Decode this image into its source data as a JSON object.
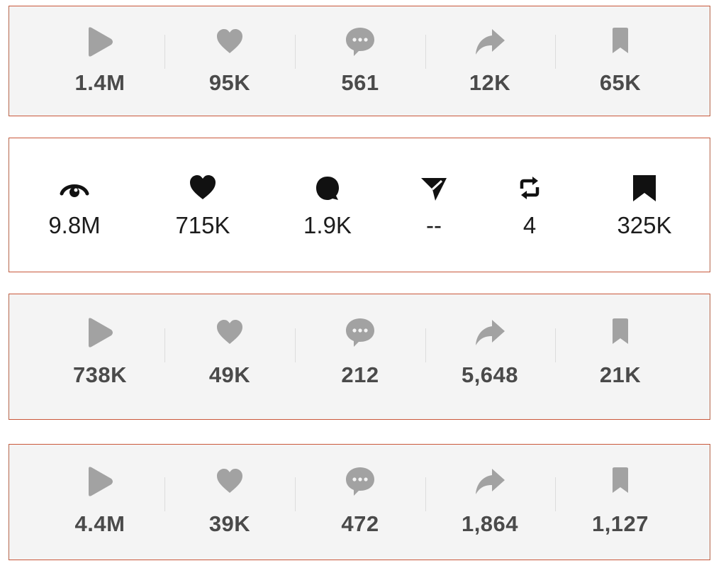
{
  "rows": [
    {
      "style": "gray",
      "stats": [
        {
          "icon": "play-icon",
          "value": "1.4M"
        },
        {
          "icon": "heart-icon",
          "value": "95K"
        },
        {
          "icon": "comment-bubble-icon",
          "value": "561"
        },
        {
          "icon": "share-arrow-icon",
          "value": "12K"
        },
        {
          "icon": "bookmark-icon",
          "value": "65K"
        }
      ]
    },
    {
      "style": "white",
      "stats": [
        {
          "icon": "eye-icon",
          "value": "9.8M"
        },
        {
          "icon": "heart-icon",
          "value": "715K"
        },
        {
          "icon": "comment-bubble-icon",
          "value": "1.9K"
        },
        {
          "icon": "send-paper-plane-icon",
          "value": "--"
        },
        {
          "icon": "repost-icon",
          "value": "4"
        },
        {
          "icon": "bookmark-icon",
          "value": "325K"
        }
      ]
    },
    {
      "style": "gray",
      "stats": [
        {
          "icon": "play-icon",
          "value": "738K"
        },
        {
          "icon": "heart-icon",
          "value": "49K"
        },
        {
          "icon": "comment-bubble-icon",
          "value": "212"
        },
        {
          "icon": "share-arrow-icon",
          "value": "5,648"
        },
        {
          "icon": "bookmark-icon",
          "value": "21K"
        }
      ]
    },
    {
      "style": "gray",
      "stats": [
        {
          "icon": "play-icon",
          "value": "4.4M"
        },
        {
          "icon": "heart-icon",
          "value": "39K"
        },
        {
          "icon": "comment-bubble-icon",
          "value": "472"
        },
        {
          "icon": "share-arrow-icon",
          "value": "1,864"
        },
        {
          "icon": "bookmark-icon",
          "value": "1,127"
        }
      ]
    }
  ],
  "colors": {
    "gray_icon": "#a2a2a2",
    "gray_value": "#4a4a4a",
    "dark_icon": "#111111",
    "dark_value": "#1c1c1c",
    "panel_gray": "#f4f4f4",
    "panel_border": "#c9573a"
  }
}
